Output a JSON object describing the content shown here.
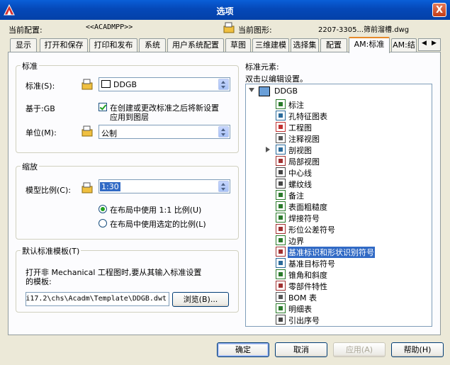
{
  "window": {
    "title": "选项",
    "close_glyph": "X"
  },
  "header": {
    "profile_label": "当前配置:",
    "profile_value": "<<ACADMPP>>",
    "drawing_label": "当前图形:",
    "drawing_value": "2207-3305...筛前溜槽.dwg"
  },
  "tabs": [
    {
      "label": "显示",
      "active": false
    },
    {
      "label": "打开和保存",
      "active": false
    },
    {
      "label": "打印和发布",
      "active": false
    },
    {
      "label": "系统",
      "active": false
    },
    {
      "label": "用户系统配置",
      "active": false
    },
    {
      "label": "草图",
      "active": false
    },
    {
      "label": "三维建模",
      "active": false
    },
    {
      "label": "选择集",
      "active": false
    },
    {
      "label": "配置",
      "active": false
    },
    {
      "label": "AM:标准",
      "active": true
    },
    {
      "label": "AM:结",
      "active": false
    }
  ],
  "standard_group": {
    "title": "标准",
    "standard_label": "标准(S):",
    "standard_value": "DDGB",
    "based_on_label": "基于:GB",
    "reset_checkbox_label_line1": "在创建或更改标准之后将新设置",
    "reset_checkbox_label_line2": "应用到图层",
    "reset_checked": true,
    "unit_label": "单位(M):",
    "unit_value": "公制"
  },
  "scale_group": {
    "title": "缩放",
    "model_scale_label": "模型比例(C):",
    "model_scale_value": "1:30",
    "radio_1to1_label": "在布局中使用 1:1 比例(U)",
    "radio_selected_label": "在布局中使用选定的比例(L)",
    "selected_radio": "1to1"
  },
  "template_group": {
    "title": "默认标准模板(T)",
    "description_line1": "打开非 Mechanical 工程图时,要从其输入标准设置",
    "description_line2": "的模板:",
    "path_value": "i17.2\\chs\\Acadm\\Template\\DDGB.dwt",
    "browse_label": "浏览(B)..."
  },
  "elements_panel": {
    "title": "标准元素:",
    "hint": "双击以编辑设置。",
    "root": "DDGB",
    "items": [
      {
        "label": "标注",
        "icon": "dimension-icon",
        "expandable": false
      },
      {
        "label": "孔特征图表",
        "icon": "hole-chart-icon",
        "expandable": false
      },
      {
        "label": "工程图",
        "icon": "drawing-icon",
        "expandable": false
      },
      {
        "label": "注释视图",
        "icon": "annotation-view-icon",
        "expandable": false
      },
      {
        "label": "剖视图",
        "icon": "section-view-icon",
        "expandable": true
      },
      {
        "label": "局部视图",
        "icon": "detail-view-icon",
        "expandable": false
      },
      {
        "label": "中心线",
        "icon": "centerline-icon",
        "expandable": false
      },
      {
        "label": "螺纹线",
        "icon": "thread-icon",
        "expandable": false
      },
      {
        "label": "备注",
        "icon": "note-icon",
        "expandable": false
      },
      {
        "label": "表面粗糙度",
        "icon": "surface-roughness-icon",
        "expandable": false
      },
      {
        "label": "焊接符号",
        "icon": "weld-symbol-icon",
        "expandable": false
      },
      {
        "label": "形位公差符号",
        "icon": "tolerance-symbol-icon",
        "expandable": false
      },
      {
        "label": "边界",
        "icon": "border-icon",
        "expandable": false
      },
      {
        "label": "基准标识和形状识别符号",
        "icon": "datum-id-icon",
        "expandable": false,
        "selected": true
      },
      {
        "label": "基准目标符号",
        "icon": "datum-target-icon",
        "expandable": false
      },
      {
        "label": "锥角和斜度",
        "icon": "taper-slope-icon",
        "expandable": false
      },
      {
        "label": "零部件特性",
        "icon": "part-properties-icon",
        "expandable": false
      },
      {
        "label": "BOM 表",
        "icon": "bom-icon",
        "expandable": false
      },
      {
        "label": "明细表",
        "icon": "parts-list-icon",
        "expandable": false
      },
      {
        "label": "引出序号",
        "icon": "balloon-icon",
        "expandable": false
      }
    ]
  },
  "buttons": {
    "ok": "确定",
    "cancel": "取消",
    "apply": "应用(A)",
    "help": "帮助(H)"
  },
  "colors": {
    "accent": "#316ac5",
    "title_bar": "#0548b8",
    "tab_highlight": "#e68b2c"
  }
}
